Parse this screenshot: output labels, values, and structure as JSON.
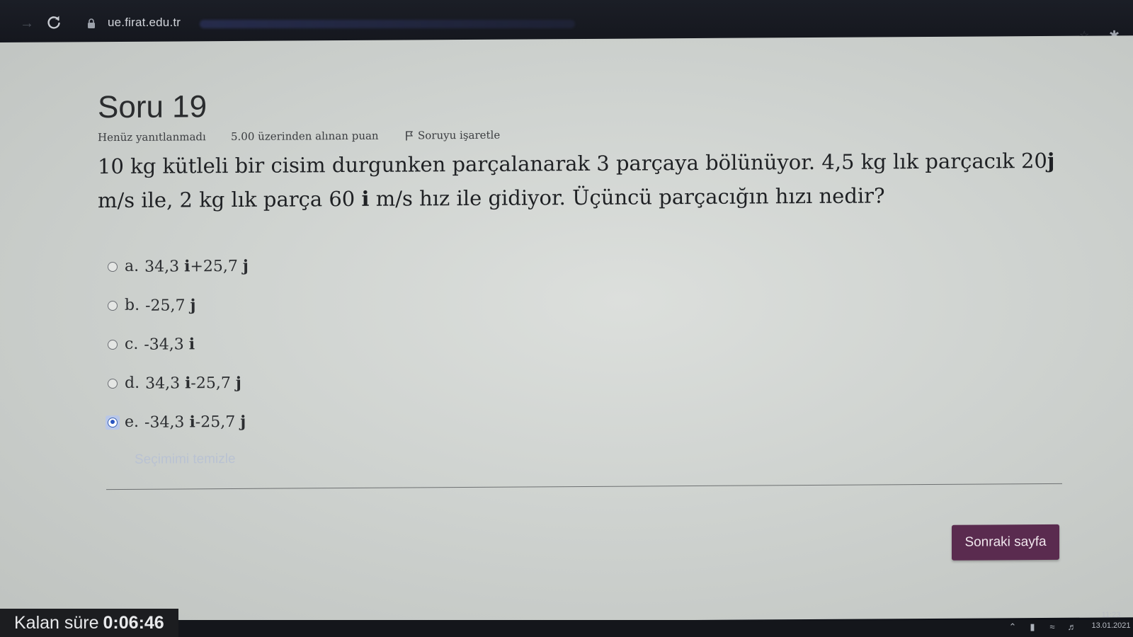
{
  "browser": {
    "url": "ue.firat.edu.tr"
  },
  "question": {
    "title": "Soru 19",
    "status": "Henüz yanıtlanmadı",
    "points": "5.00 üzerinden alınan puan",
    "flag_label": "Soruyu işaretle",
    "text_part1": "10 kg kütleli bir cisim durgunken parçalanarak 3 parçaya bölünüyor. 4,5 kg lık parçacık 20",
    "text_bold1": "j",
    "text_part2": " m/s ile, 2 kg lık parça  60 ",
    "text_bold2": "i",
    "text_part3": " m/s hız ile gidiyor. Üçüncü parçacığın hızı nedir?"
  },
  "options": [
    {
      "letter": "a.",
      "pre": "34,3 ",
      "b1": "i",
      "mid": "+25,7 ",
      "b2": "j",
      "selected": false
    },
    {
      "letter": "b.",
      "pre": "-25,7 ",
      "b1": "j",
      "mid": "",
      "b2": "",
      "selected": false
    },
    {
      "letter": "c.",
      "pre": "-34,3 ",
      "b1": "i",
      "mid": "",
      "b2": "",
      "selected": false
    },
    {
      "letter": "d.",
      "pre": "34,3 ",
      "b1": "i",
      "mid": "-25,7 ",
      "b2": "j",
      "selected": false
    },
    {
      "letter": "e.",
      "pre": "-34,3 ",
      "b1": "i",
      "mid": "-25,7 ",
      "b2": "j",
      "selected": true
    }
  ],
  "clear_choice": "Seçimimi temizle",
  "next_button": "Sonraki sayfa",
  "timer": {
    "label": "Kalan süre",
    "value": "0:06:46"
  },
  "clock": {
    "time": "11:23",
    "date": "13.01.2021"
  },
  "colors": {
    "next_button_bg": "#5a2b4f",
    "selected_radio": "#2a55c0"
  }
}
